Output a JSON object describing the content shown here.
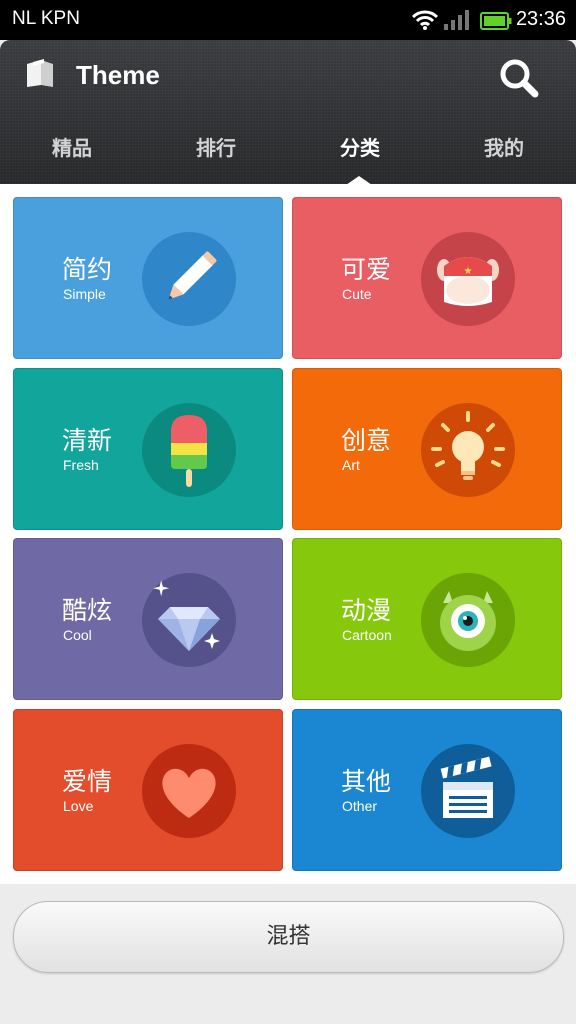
{
  "status_bar": {
    "carrier": "NL KPN",
    "time": "23:36",
    "icons": [
      "wifi-icon",
      "signal-icon",
      "battery-icon"
    ]
  },
  "header": {
    "title": "Theme",
    "app_icon": "theme-book-icon",
    "search_icon": "search-icon"
  },
  "tabs": [
    {
      "label": "精品",
      "active": false
    },
    {
      "label": "排行",
      "active": false
    },
    {
      "label": "分类",
      "active": true
    },
    {
      "label": "我的",
      "active": false
    }
  ],
  "categories": [
    {
      "zh": "简约",
      "en": "Simple",
      "color": "#4aa0dd",
      "circle": "#2f86c8",
      "icon": "pencil-icon"
    },
    {
      "zh": "可爱",
      "en": "Cute",
      "color": "#e85e62",
      "circle": "#c4444a",
      "icon": "cute-mascot-icon"
    },
    {
      "zh": "清新",
      "en": "Fresh",
      "color": "#12a59b",
      "circle": "#0b8a80",
      "icon": "popsicle-icon"
    },
    {
      "zh": "创意",
      "en": "Art",
      "color": "#f26a0a",
      "circle": "#cf4a06",
      "icon": "lightbulb-icon"
    },
    {
      "zh": "酷炫",
      "en": "Cool",
      "color": "#6f69a6",
      "circle": "#55518a",
      "icon": "diamond-icon"
    },
    {
      "zh": "动漫",
      "en": "Cartoon",
      "color": "#86c80c",
      "circle": "#6aa405",
      "icon": "one-eye-monster-icon"
    },
    {
      "zh": "爱情",
      "en": "Love",
      "color": "#e34d2c",
      "circle": "#bd2b13",
      "icon": "heart-icon"
    },
    {
      "zh": "其他",
      "en": "Other",
      "color": "#1b87d3",
      "circle": "#0f5e99",
      "icon": "clapperboard-icon"
    }
  ],
  "mix_button": {
    "label": "混搭"
  }
}
